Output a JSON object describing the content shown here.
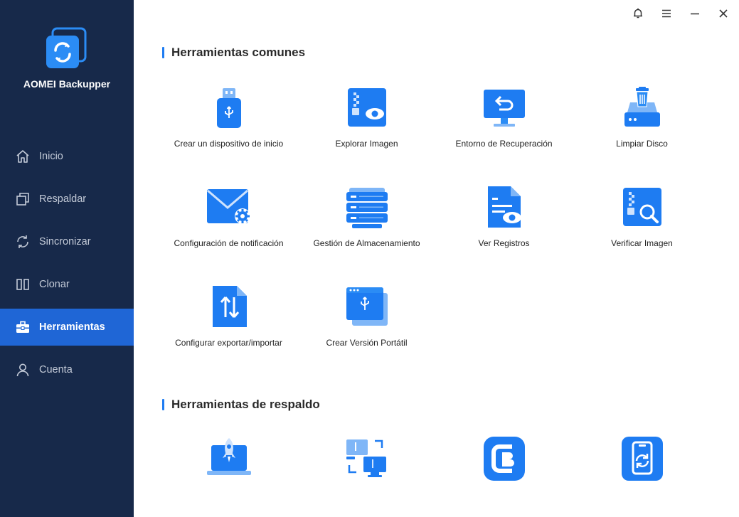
{
  "app": {
    "name": "AOMEI Backupper"
  },
  "colors": {
    "sidebar_bg": "#17294a",
    "accent": "#1f66d6",
    "icon_blue": "#1e7cf2"
  },
  "window_controls": [
    {
      "name": "notification-bell-icon"
    },
    {
      "name": "menu-icon"
    },
    {
      "name": "minimize-icon"
    },
    {
      "name": "close-icon"
    }
  ],
  "sidebar": {
    "items": [
      {
        "label": "Inicio",
        "icon": "home-icon",
        "active": false
      },
      {
        "label": "Respaldar",
        "icon": "backup-icon",
        "active": false
      },
      {
        "label": "Sincronizar",
        "icon": "sync-icon",
        "active": false
      },
      {
        "label": "Clonar",
        "icon": "clone-icon",
        "active": false
      },
      {
        "label": "Herramientas",
        "icon": "toolbox-icon",
        "active": true
      },
      {
        "label": "Cuenta",
        "icon": "user-icon",
        "active": false
      }
    ]
  },
  "sections": {
    "common": {
      "title": "Herramientas comunes",
      "tools": [
        {
          "label": "Crear un dispositivo de inicio",
          "icon": "usb-drive-icon"
        },
        {
          "label": "Explorar Imagen",
          "icon": "explore-image-icon"
        },
        {
          "label": "Entorno de Recuperación",
          "icon": "recovery-environment-icon"
        },
        {
          "label": "Limpiar Disco",
          "icon": "wipe-disk-icon"
        },
        {
          "label": "Configuración de notificación",
          "icon": "email-settings-icon"
        },
        {
          "label": "Gestión de Almacenamiento",
          "icon": "storage-server-icon"
        },
        {
          "label": "Ver Registros",
          "icon": "view-logs-icon"
        },
        {
          "label": "Verificar Imagen",
          "icon": "check-image-icon"
        },
        {
          "label": "Configurar exportar/importar",
          "icon": "export-import-icon"
        },
        {
          "label": "Crear Versión Portátil",
          "icon": "portable-version-icon"
        }
      ]
    },
    "backup": {
      "title": "Herramientas de respaldo",
      "tools": [
        {
          "label": "",
          "icon": "laptop-rocket-icon"
        },
        {
          "label": "",
          "icon": "image-transfer-icon"
        },
        {
          "label": "",
          "icon": "cb-app-icon"
        },
        {
          "label": "",
          "icon": "mobile-sync-icon"
        }
      ]
    }
  }
}
